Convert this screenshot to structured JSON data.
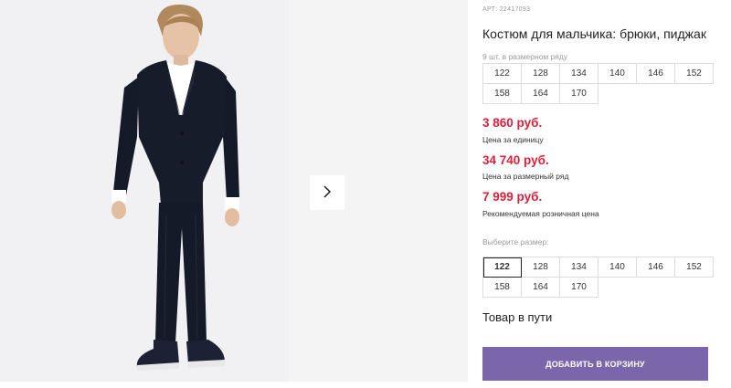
{
  "product": {
    "sku": "АРТ: 22417093",
    "title": "Костюм для мальчика: брюки, пиджак"
  },
  "pack": {
    "note": "9 шт. в размерном ряду",
    "sizes": [
      "122",
      "128",
      "134",
      "140",
      "146",
      "152",
      "158",
      "164",
      "170"
    ]
  },
  "prices": [
    {
      "value": "3 860 руб.",
      "label": "Цена за единицу"
    },
    {
      "value": "34 740 руб.",
      "label": "Цена за размерный ряд"
    },
    {
      "value": "7 999 руб.",
      "label": "Рекомендуемая розничная цена"
    }
  ],
  "size_select": {
    "label": "Выберите размер:",
    "sizes": [
      "122",
      "128",
      "134",
      "140",
      "146",
      "152",
      "158",
      "164",
      "170"
    ],
    "selected": "122"
  },
  "status": "Товар в пути",
  "cart_button": "ДОБАВИТЬ В КОРЗИНУ",
  "gallery": {
    "next_icon": "chevron-right-icon"
  },
  "colors": {
    "price": "#e0203a",
    "button": "#7b66ac"
  }
}
